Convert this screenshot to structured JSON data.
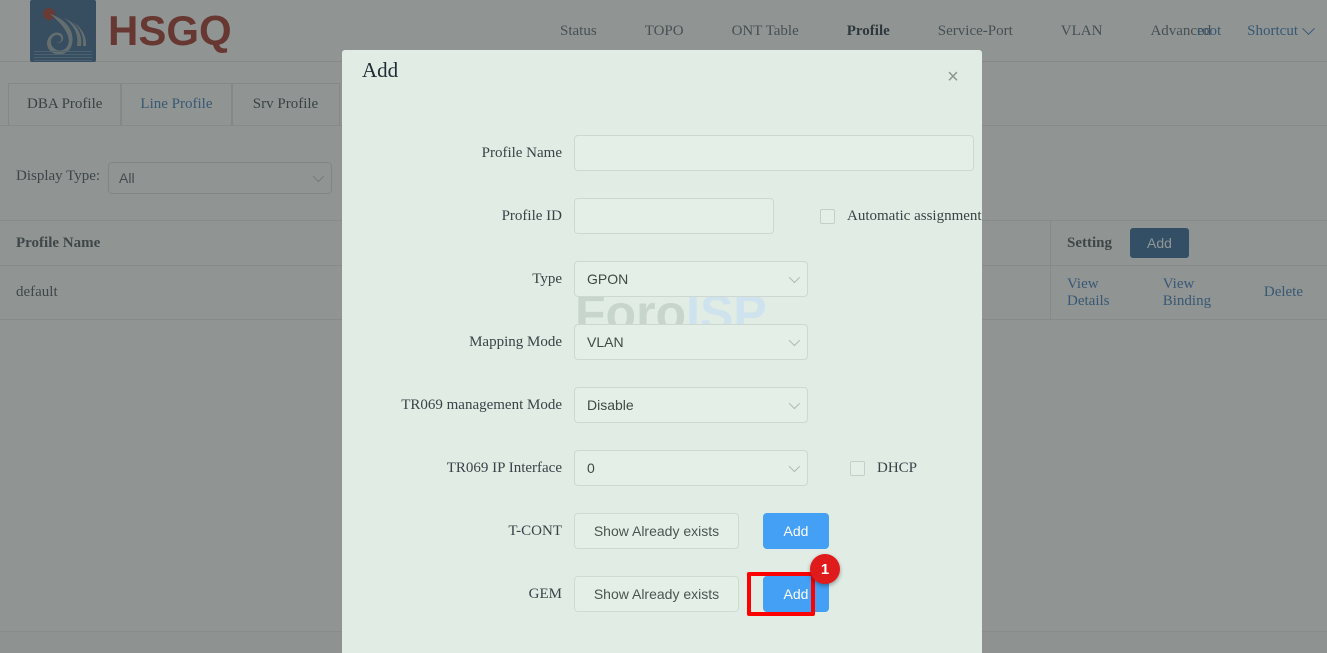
{
  "header": {
    "brand": "HSGQ",
    "nav_items": [
      {
        "label": "Status",
        "active": false
      },
      {
        "label": "TOPO",
        "active": false
      },
      {
        "label": "ONT Table",
        "active": false
      },
      {
        "label": "Profile",
        "active": true
      },
      {
        "label": "Service-Port",
        "active": false
      },
      {
        "label": "VLAN",
        "active": false
      },
      {
        "label": "Advanced",
        "active": false
      }
    ],
    "user": "root",
    "shortcut": "Shortcut"
  },
  "tabs": [
    {
      "label": "DBA Profile",
      "active": false
    },
    {
      "label": "Line Profile",
      "active": true
    },
    {
      "label": "Srv Profile",
      "active": false
    }
  ],
  "filter": {
    "label": "Display Type:",
    "value": "All"
  },
  "table": {
    "columns": [
      "Profile Name",
      "Setting"
    ],
    "header_add_button": "Add",
    "rows": [
      {
        "profile_name": "default",
        "actions": [
          "View Details",
          "View Binding",
          "Delete"
        ]
      }
    ]
  },
  "watermark": {
    "part1": "Foro",
    "part2": "ISP"
  },
  "modal": {
    "title": "Add",
    "close_icon": "×",
    "fields": {
      "profile_name": {
        "label": "Profile Name",
        "value": "",
        "placeholder": ""
      },
      "profile_id": {
        "label": "Profile ID",
        "value": "",
        "placeholder": ""
      },
      "automatic_assignment": {
        "label": "Automatic assignment",
        "checked": false
      },
      "type": {
        "label": "Type",
        "value": "GPON"
      },
      "mapping_mode": {
        "label": "Mapping Mode",
        "value": "VLAN"
      },
      "tr069_management_mode": {
        "label": "TR069 management Mode",
        "value": "Disable"
      },
      "tr069_ip_interface": {
        "label": "TR069 IP Interface",
        "value": "0"
      },
      "dhcp": {
        "label": "DHCP",
        "checked": false
      },
      "tcont": {
        "label": "T-CONT",
        "show_button": "Show Already exists",
        "add_button": "Add"
      },
      "gem": {
        "label": "GEM",
        "show_button": "Show Already exists",
        "add_button": "Add"
      }
    }
  },
  "annotation": {
    "badge_number": "1",
    "highlight_color": "#ff0000",
    "badge_color": "#e01b1b"
  },
  "colors": {
    "brand_red": "#9e2117",
    "logo_blue": "#2b5584",
    "link_blue": "#2f6bb0",
    "button_blue": "#43a0f5",
    "dark_button_blue": "#21598f",
    "modal_bg": "#e0ece4"
  }
}
